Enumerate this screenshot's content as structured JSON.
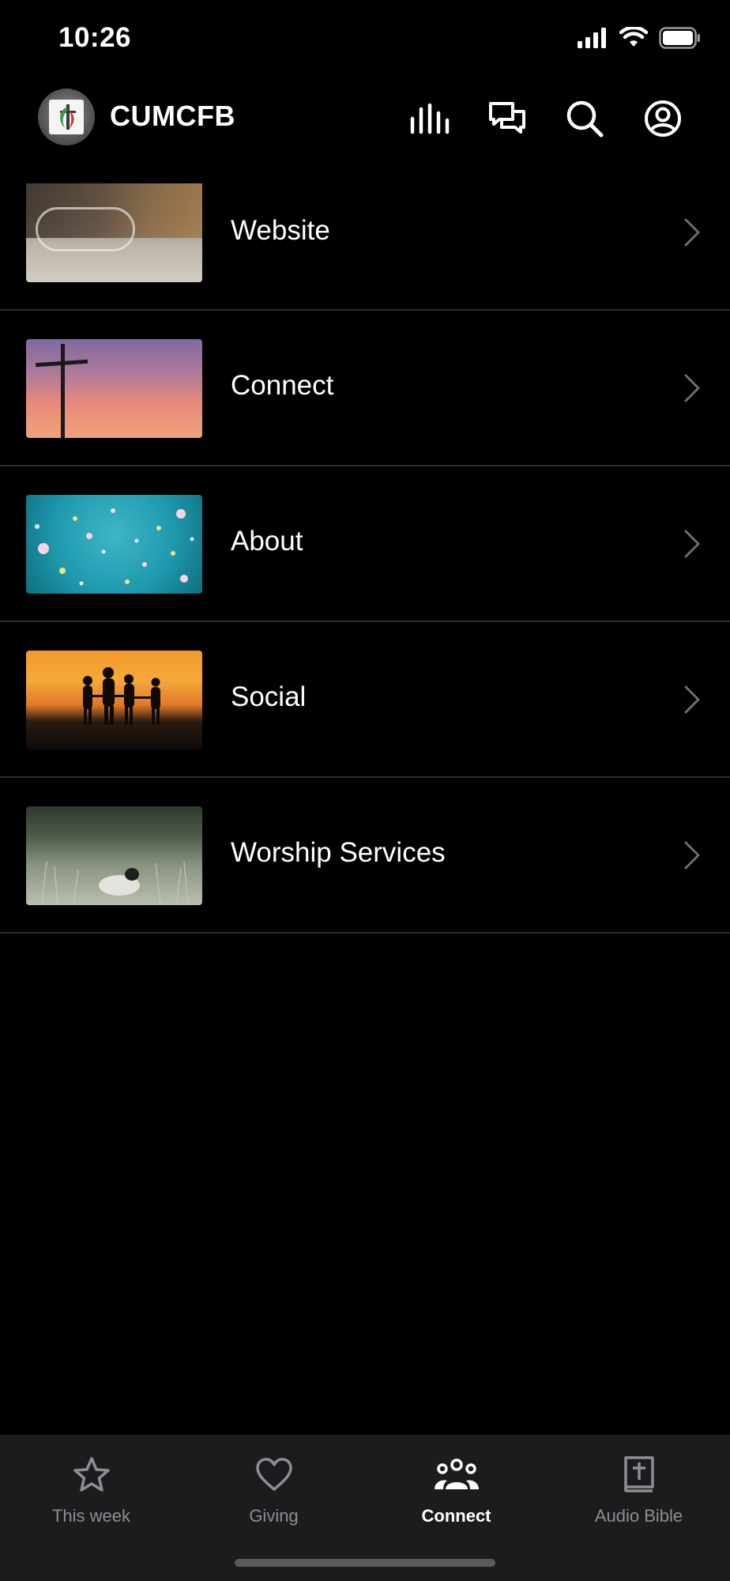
{
  "status_bar": {
    "time": "10:26",
    "icons": [
      "cellular-signal-icon",
      "wifi-icon",
      "battery-icon"
    ]
  },
  "header": {
    "app_name": "CUMCFB",
    "actions": [
      "equalizer-icon",
      "chat-bubbles-icon",
      "search-icon",
      "profile-icon"
    ]
  },
  "list": {
    "items": [
      {
        "label": "Website",
        "thumb": "living-room-photo"
      },
      {
        "label": "Connect",
        "thumb": "cross-sunset-photo"
      },
      {
        "label": "About",
        "thumb": "confetti-photo"
      },
      {
        "label": "Social",
        "thumb": "family-silhouette-photo"
      },
      {
        "label": "Worship Services",
        "thumb": "sheep-field-photo"
      }
    ]
  },
  "tab_bar": {
    "tabs": [
      {
        "label": "This week",
        "icon": "star-icon",
        "active": false
      },
      {
        "label": "Giving",
        "icon": "heart-icon",
        "active": false
      },
      {
        "label": "Connect",
        "icon": "people-icon",
        "active": true
      },
      {
        "label": "Audio Bible",
        "icon": "bible-icon",
        "active": false
      }
    ]
  },
  "colors": {
    "background": "#000000",
    "tab_bar_bg": "#1c1c1e",
    "inactive_tab": "#8e8e93",
    "divider": "#2a2a2a",
    "chevron": "#6e6e73"
  }
}
